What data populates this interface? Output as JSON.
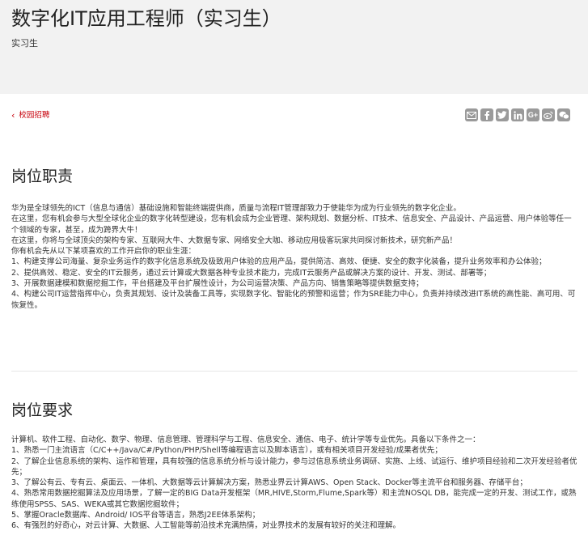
{
  "header": {
    "title": "数字化IT应用工程师（实习生）",
    "subtitle": "实习生"
  },
  "nav": {
    "back_label": "校园招聘"
  },
  "share": [
    "mail-icon",
    "facebook-icon",
    "twitter-icon",
    "linkedin-icon",
    "google-plus-icon",
    "weibo-icon",
    "wechat-icon"
  ],
  "responsibilities": {
    "heading": "岗位职责",
    "paragraphs": [
      "华为是全球领先的ICT（信息与通信）基础设施和智能终端提供商，质量与流程IT管理部致力于使能华为成为行业领先的数字化企业。",
      "在这里，您有机会参与大型全球化企业的数字化转型建设，您有机会成为企业管理、架构规划、数据分析、IT技术、信息安全、产品设计、产品运营、用户体验等任一个领域的专家，甚至，成为跨界大牛！",
      "在这里，你将与全球顶尖的架构专家、互联网大牛、大数据专家、网络安全大咖、移动应用极客玩家共同探讨新技术，研究新产品！",
      "你有机会先从以下某项喜欢的工作开启你的职业生涯：",
      "1、构建支撑公司海量、复杂业务运作的数字化信息系统及极致用户体验的应用产品，提供简洁、高效、便捷、安全的数字化装备，提升业务效率和办公体验；",
      "2、提供高效、稳定、安全的IT云服务，通过云计算或大数据各种专业技术能力，完成IT云服务产品或解决方案的设计、开发、测试、部署等；",
      "3、开展数据建模和数据挖掘工作，平台搭建及平台扩展性设计，为公司运营决策、产品方向、销售策略等提供数据支持；",
      "4、构建公司IT运营指挥中心，负责其规划、设计及装备工具等，实现数字化、智能化的预警和运营；作为SRE能力中心，负责并持续改进IT系统的高性能、高可用、可恢复性。"
    ]
  },
  "requirements": {
    "heading": "岗位要求",
    "paragraphs": [
      "计算机、软件工程、自动化、数学、物理、信息管理、管理科学与工程、信息安全、通信、电子、统计学等专业优先。具备以下条件之一：",
      "1、熟悉一门主流语言（C/C++/Java/C#/Python/PHP/Shell等编程语言以及脚本语言），或有相关项目开发经验/成果者优先；",
      "2、了解企业信息系统的架构、运作和管理，具有较强的信息系统分析与设计能力，参与过信息系统业务调研、实施、上线、试运行、维护项目经验和二次开发经验者优先；",
      "3、了解公有云、专有云、桌面云、一体机、大数据等云计算解决方案，熟悉业界云计算AWS、Open Stack、Docker等主流平台和服务器、存储平台；",
      "4、熟悉常用数据挖掘算法及应用场景，了解一定的BIG Data开发框架（MR,HIVE,Storm,Flume,Spark等）和主流NOSQL DB，能完成一定的开发、测试工作，或熟练使用SPSS、SAS、WEKA或其它数据挖掘软件；",
      "5、掌握Oracle数据库、Android/ IOS平台等语言，熟悉J2EE体系架构；",
      "6、有强烈的好奇心，对云计算、大数据、人工智能等前沿技术充满热情，对业界技术的发展有较好的关注和理解。"
    ]
  }
}
